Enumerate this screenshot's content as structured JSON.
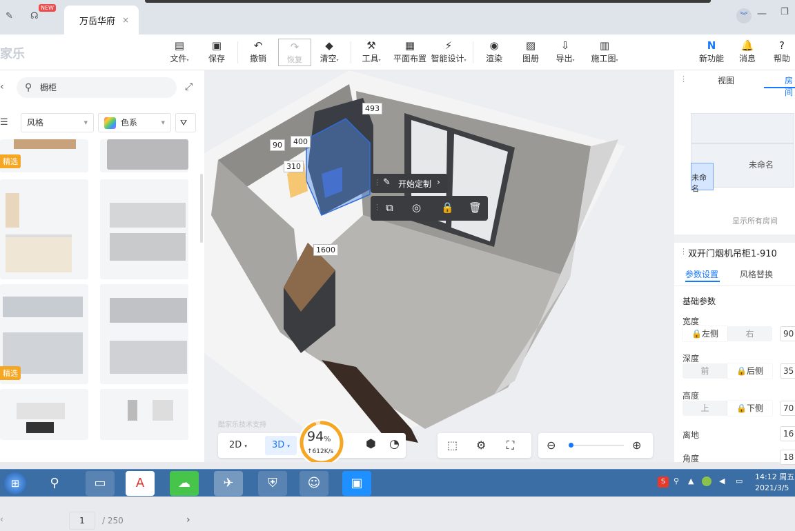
{
  "browser": {
    "new_badge": "NEW",
    "tab_title": "万岳华府",
    "tab_close": "×"
  },
  "toolbar": {
    "logo": "家乐",
    "tools": [
      {
        "label": "文件",
        "icon": "file-icon"
      },
      {
        "label": "保存",
        "icon": "save-icon"
      },
      {
        "label": "撤销",
        "icon": "undo-icon"
      },
      {
        "label": "恢复",
        "icon": "redo-icon"
      },
      {
        "label": "清空",
        "icon": "eraser-icon"
      },
      {
        "label": "工具",
        "icon": "wrench-icon"
      },
      {
        "label": "平面布置",
        "icon": "floorplan-icon"
      },
      {
        "label": "智能设计",
        "icon": "lightning-icon"
      },
      {
        "label": "渲染",
        "icon": "camera-icon"
      },
      {
        "label": "图册",
        "icon": "album-icon"
      },
      {
        "label": "导出",
        "icon": "export-icon"
      },
      {
        "label": "施工图",
        "icon": "blueprint-icon"
      }
    ],
    "right": [
      {
        "label": "新功能",
        "icon": "new-feature-icon"
      },
      {
        "label": "消息",
        "icon": "bell-icon"
      },
      {
        "label": "帮助",
        "icon": "help-icon"
      }
    ]
  },
  "left": {
    "search_value": "橱柜",
    "filter_style": "风格",
    "filter_color": "色系",
    "badge": "精选",
    "page_current": "1",
    "page_total": "/ 250"
  },
  "canvas": {
    "dims": [
      "493",
      "400",
      "90",
      "310",
      "1600"
    ],
    "ctx_title": "开始定制",
    "watermark": "酷家乐技术支持",
    "mode_2d": "2D",
    "mode_3d": "3D",
    "progress_percent": "94",
    "progress_value": 94,
    "percent_sign": "%",
    "speed": "↑612K/s"
  },
  "right": {
    "tab_view": "视图",
    "tab_room": "房间",
    "room_unnamed_1": "未命名",
    "room_unnamed_2": "未命名",
    "show_all_rooms": "显示所有房间",
    "object_title": "双开门烟机吊柜1-910",
    "tab_params": "参数设置",
    "tab_style": "风格替换",
    "section_basic": "基础参数",
    "params": [
      {
        "label": "宽度",
        "opt1": "左侧",
        "opt2": "右",
        "value": "90"
      },
      {
        "label": "深度",
        "opt1": "前",
        "opt2": "后侧",
        "value": "35"
      },
      {
        "label": "高度",
        "opt1": "上",
        "opt2": "下侧",
        "value": "70"
      }
    ],
    "ground_label": "离地",
    "ground_value": "16",
    "angle_label": "角度",
    "angle_value": "18"
  },
  "taskbar": {
    "time": "14:12 周五",
    "date": "2021/3/5"
  },
  "colors": {
    "accent": "#1677ff",
    "progress": "#f5a623",
    "badge": "#f5a623"
  }
}
